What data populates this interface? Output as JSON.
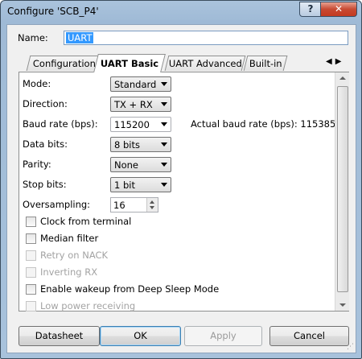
{
  "window": {
    "title": "Configure 'SCB_P4'",
    "help_glyph": "?",
    "close_glyph": "✕"
  },
  "name": {
    "label": "Name:",
    "value": "UART"
  },
  "tabs": [
    {
      "label": "Configuration",
      "active": false
    },
    {
      "label": "UART Basic",
      "active": true
    },
    {
      "label": "UART Advanced",
      "active": false
    },
    {
      "label": "Built-in",
      "active": false
    }
  ],
  "tab_scroll": {
    "left": "◀",
    "right": "▶"
  },
  "fields": {
    "mode": {
      "label": "Mode:",
      "value": "Standard"
    },
    "direction": {
      "label": "Direction:",
      "value": "TX + RX"
    },
    "baud": {
      "label": "Baud rate (bps):",
      "value": "115200",
      "actual": "Actual baud rate (bps): 115385"
    },
    "data_bits": {
      "label": "Data bits:",
      "value": "8 bits"
    },
    "parity": {
      "label": "Parity:",
      "value": "None"
    },
    "stop_bits": {
      "label": "Stop bits:",
      "value": "1 bit"
    },
    "oversampling": {
      "label": "Oversampling:",
      "value": "16"
    }
  },
  "checkboxes": [
    {
      "label": "Clock from terminal",
      "checked": false,
      "enabled": true
    },
    {
      "label": "Median filter",
      "checked": false,
      "enabled": true
    },
    {
      "label": "Retry on NACK",
      "checked": false,
      "enabled": false
    },
    {
      "label": "Inverting RX",
      "checked": false,
      "enabled": false
    },
    {
      "label": "Enable wakeup from Deep Sleep Mode",
      "checked": false,
      "enabled": true
    },
    {
      "label": "Low power receiving",
      "checked": false,
      "enabled": false
    }
  ],
  "buttons": {
    "datasheet": "Datasheet",
    "ok": "OK",
    "apply": "Apply",
    "cancel": "Cancel"
  }
}
